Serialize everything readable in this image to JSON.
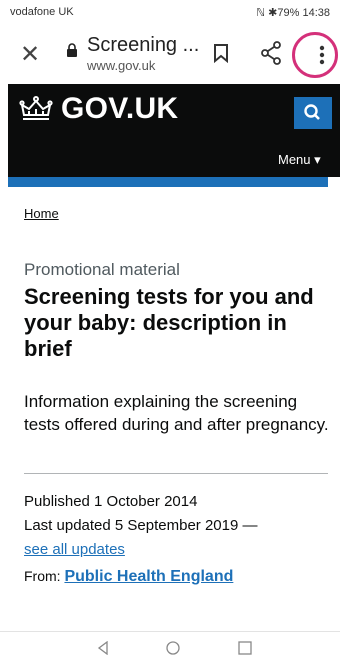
{
  "status_bar": {
    "carrier": "vodafone UK",
    "right": "ℕ ✱79% 14:38"
  },
  "browser": {
    "tab_title": "Screening ...",
    "url": "www.gov.uk",
    "icons": [
      "close-icon",
      "lock-icon",
      "bookmark-icon",
      "share-icon",
      "more-options-icon"
    ],
    "highlight_color": "#d4307a"
  },
  "gov_header": {
    "logo_text": "GOV.UK",
    "menu_label": "Menu ▾",
    "colors": {
      "background": "#0b0c0c",
      "search_button": "#1d70b8"
    }
  },
  "breadcrumb": {
    "home": "Home"
  },
  "main": {
    "caption": "Promotional material",
    "title": "Screening tests for you and your baby: description in brief",
    "lead": "Information explaining the screening tests offered during and after pregnancy.",
    "published": "Published 1 October 2014",
    "last_updated": "Last updated 5 September 2019 —",
    "see_all_updates": "see all updates",
    "from_label": "From:",
    "from_org": "Public Health England",
    "link_color": "#1d70b8"
  },
  "android_nav": {
    "icons": [
      "back-icon",
      "home-icon",
      "recents-icon"
    ]
  }
}
